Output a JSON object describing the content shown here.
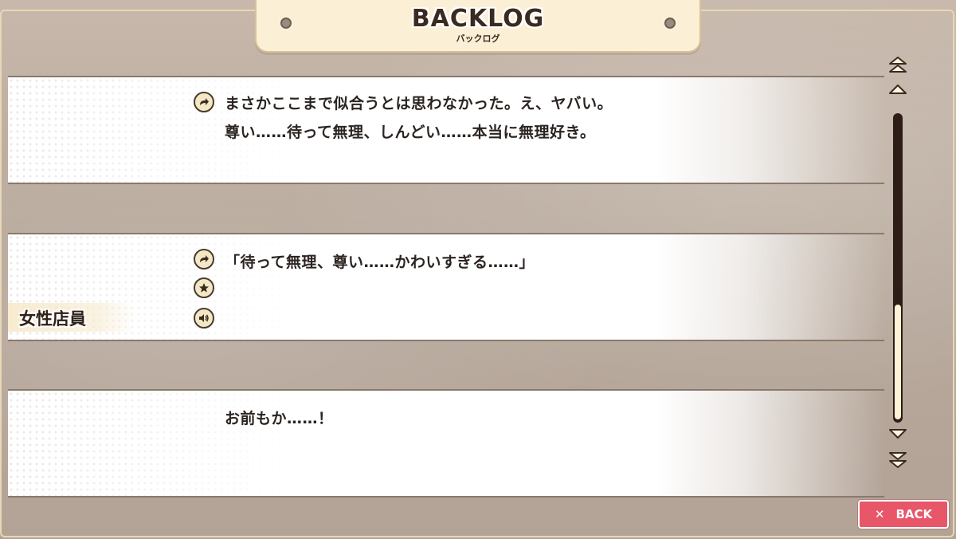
{
  "header": {
    "title": "BACKLOG",
    "subtitle": "バックログ"
  },
  "entries": [
    {
      "speaker": "",
      "lines": [
        "まさかここまで似合うとは思わなかった。え、ヤバい。",
        "尊い……待って無理、しんどい……本当に無理好き。"
      ],
      "icons": [
        "jump-icon"
      ]
    },
    {
      "speaker": "女性店員",
      "lines": [
        "「待って無理、尊い……かわいすぎる……」"
      ],
      "icons": [
        "jump-icon",
        "star-icon",
        "speaker-icon"
      ]
    },
    {
      "speaker": "",
      "lines": [
        "お前もか……！"
      ],
      "icons": []
    }
  ],
  "scrollbar": {
    "top_icon": "double-chevron-up-icon",
    "up_icon": "chevron-up-icon",
    "down_icon": "chevron-down-icon",
    "bottom_icon": "double-chevron-down-icon",
    "position_fraction": 1.0
  },
  "back_button": {
    "icon": "close-icon",
    "icon_glyph": "✕",
    "label": "BACK",
    "color": "#e8566a"
  }
}
